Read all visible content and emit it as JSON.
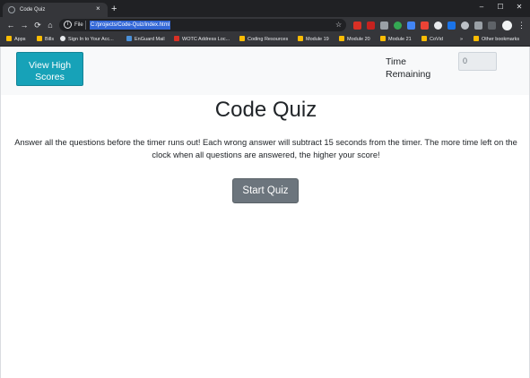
{
  "browser": {
    "tab_title": "Code Quiz",
    "tab_close": "×",
    "new_tab": "+",
    "omnibox_info": "i",
    "omnibox_scheme": "File",
    "url": "C:/projects/Code-Quiz/index.html",
    "star": "☆",
    "window_controls": {
      "minimize": "–",
      "maximize": "☐",
      "close": "✕"
    },
    "nav": {
      "back": "←",
      "forward": "→",
      "reload": "⟳",
      "home": "⌂"
    },
    "menu": "⋮",
    "bookmarks": [
      {
        "label": "Apps",
        "icon": "apps-grid-icon",
        "color": "#fbbc04"
      },
      {
        "label": "Bills",
        "icon": "folder-icon",
        "color": "#fbbc04"
      },
      {
        "label": "Sign In to Your Acc...",
        "icon": "site-icon",
        "color": "#e8eaed"
      },
      {
        "label": "EnGuard Mail",
        "icon": "site-icon",
        "color": "#4a90d9"
      },
      {
        "label": "WOTC Address Loc...",
        "icon": "site-icon",
        "color": "#d93025"
      },
      {
        "label": "Coding Resources",
        "icon": "folder-icon",
        "color": "#fbbc04"
      },
      {
        "label": "Module 19",
        "icon": "folder-icon",
        "color": "#fbbc04"
      },
      {
        "label": "Module 20",
        "icon": "folder-icon",
        "color": "#fbbc04"
      },
      {
        "label": "Module 21",
        "icon": "folder-icon",
        "color": "#fbbc04"
      },
      {
        "label": "CoVid",
        "icon": "folder-icon",
        "color": "#fbbc04"
      }
    ],
    "bookmarks_overflow": "»",
    "other_bookmarks": "Other bookmarks"
  },
  "header": {
    "highscores_label": "View High Scores",
    "time_label": "Time Remaining",
    "time_value": "0"
  },
  "main": {
    "title": "Code Quiz",
    "instructions": "Answer all the questions before the timer runs out! Each wrong answer will subtract 15 seconds from the timer. The more time left on the clock when all questions are answered, the higher your score!",
    "start_label": "Start Quiz"
  },
  "colors": {
    "highscores_button": "#17a2b8",
    "start_button": "#6c757d",
    "header_background": "#f8f9fa"
  }
}
